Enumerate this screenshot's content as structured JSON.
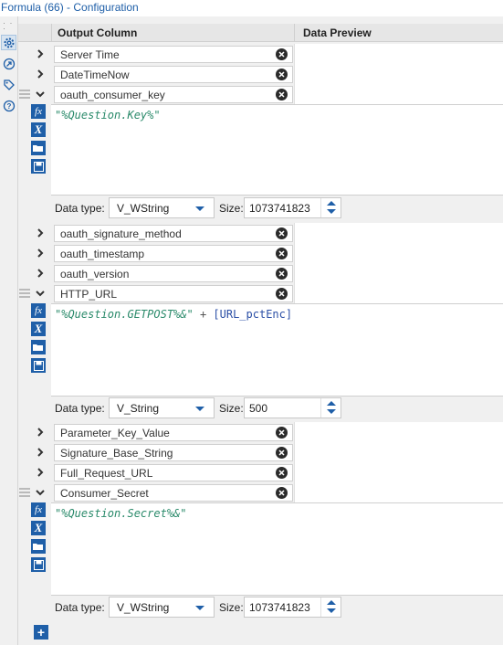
{
  "window": {
    "title": "Formula (66) - Configuration"
  },
  "sidebar": {
    "icons": [
      "gear-icon",
      "navigate-icon",
      "tag-icon",
      "help-icon"
    ]
  },
  "table": {
    "col_output": "Output Column",
    "col_preview": "Data Preview"
  },
  "fields": [
    {
      "name": "Server Time",
      "expanded": false
    },
    {
      "name": "DateTimeNow",
      "expanded": false
    },
    {
      "name": "oauth_consumer_key",
      "expanded": true
    },
    {
      "name": "oauth_signature_method",
      "expanded": false
    },
    {
      "name": "oauth_timestamp",
      "expanded": false
    },
    {
      "name": "oauth_version",
      "expanded": false
    },
    {
      "name": "HTTP_URL",
      "expanded": true
    },
    {
      "name": "Parameter_Key_Value",
      "expanded": false
    },
    {
      "name": "Signature_Base_String",
      "expanded": false
    },
    {
      "name": "Full_Request_URL",
      "expanded": false
    },
    {
      "name": "Consumer_Secret",
      "expanded": true
    }
  ],
  "editors": [
    {
      "expr_string": "\"%Question.Key%\"",
      "expr_op": "",
      "expr_field": "",
      "data_type_label": "Data type:",
      "data_type": "V_WString",
      "size_label": "Size:",
      "size": "1073741823"
    },
    {
      "expr_string": "\"%Question.GETPOST%&\"",
      "expr_op": " + ",
      "expr_field": "[URL_pctEnc]",
      "data_type_label": "Data type:",
      "data_type": "V_String",
      "size_label": "Size:",
      "size": "500"
    },
    {
      "expr_string": "\"%Question.Secret%&\"",
      "expr_op": "",
      "expr_field": "",
      "data_type_label": "Data type:",
      "data_type": "V_WString",
      "size_label": "Size:",
      "size": "1073741823"
    }
  ],
  "tools": {
    "fx": "fx",
    "var": "X",
    "add": "+"
  },
  "colors": {
    "accent": "#1f5fa8",
    "string": "#2a8a6a",
    "field": "#2b4fa6"
  }
}
